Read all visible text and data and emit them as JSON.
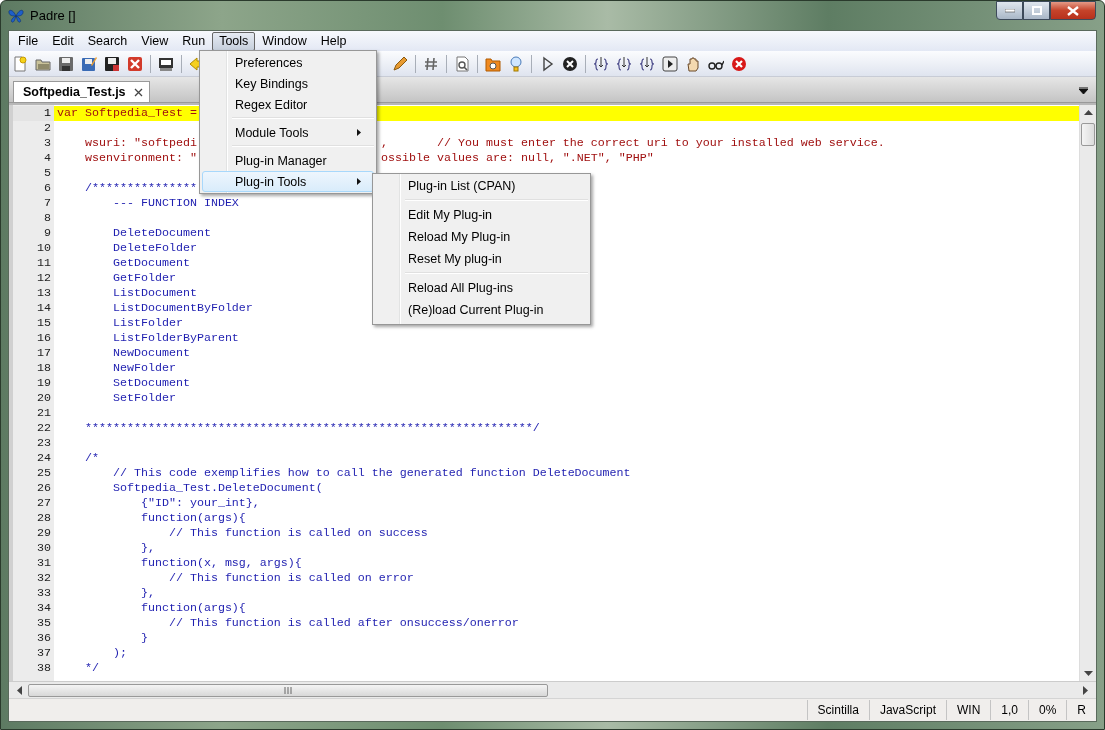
{
  "window": {
    "title": "Padre []"
  },
  "menu_bar": [
    {
      "label": "File",
      "selected": false
    },
    {
      "label": "Edit",
      "selected": false
    },
    {
      "label": "Search",
      "selected": false
    },
    {
      "label": "View",
      "selected": false
    },
    {
      "label": "Run",
      "selected": false
    },
    {
      "label": "Tools",
      "selected": true
    },
    {
      "label": "Window",
      "selected": false
    },
    {
      "label": "Help",
      "selected": false
    }
  ],
  "open_menu": {
    "items": [
      {
        "kind": "item",
        "label": "Preferences",
        "selected": false
      },
      {
        "kind": "item",
        "label": "Key Bindings",
        "selected": false
      },
      {
        "kind": "item",
        "label": "Regex Editor",
        "selected": false
      },
      {
        "kind": "separator"
      },
      {
        "kind": "submenu",
        "label": "Module Tools",
        "selected": false
      },
      {
        "kind": "separator"
      },
      {
        "kind": "item",
        "label": "Plug-in Manager",
        "selected": false
      },
      {
        "kind": "submenu",
        "label": "Plug-in Tools",
        "selected": true
      }
    ],
    "submenu": {
      "items": [
        {
          "kind": "item",
          "label": "Plug-in List (CPAN)",
          "selected": false
        },
        {
          "kind": "separator"
        },
        {
          "kind": "item",
          "label": "Edit My Plug-in",
          "selected": false
        },
        {
          "kind": "item",
          "label": "Reload My Plug-in",
          "selected": false
        },
        {
          "kind": "item",
          "label": "Reset My plug-in",
          "selected": false
        },
        {
          "kind": "separator"
        },
        {
          "kind": "item",
          "label": "Reload All Plug-ins",
          "selected": false
        },
        {
          "kind": "item",
          "label": "(Re)load Current Plug-in",
          "selected": false
        }
      ]
    }
  },
  "tabs": [
    {
      "label": "Softpedia_Test.js",
      "selected": true
    }
  ],
  "editor": {
    "lines": [
      {
        "number": "1",
        "current": true,
        "kind": "code",
        "text": "var Softpedia_Test ="
      },
      {
        "number": "2",
        "current": false,
        "kind": "code"
      },
      {
        "number": "3",
        "current": false,
        "kind": "code",
        "text": "    wsuri: \"softpedi",
        "past_menu": ",       // You must enter the correct uri to your installed web service."
      },
      {
        "number": "4",
        "current": false,
        "kind": "code",
        "text": "    wsenvironment: \"",
        "past_menu": "ossible values are: null, \".NET\", \"PHP\""
      },
      {
        "number": "5",
        "current": false,
        "kind": "code"
      },
      {
        "number": "6",
        "current": false,
        "kind": "comment",
        "text": "    /***************"
      },
      {
        "number": "7",
        "current": false,
        "kind": "comment",
        "text": "        --- FUNCTION INDEX"
      },
      {
        "number": "8",
        "current": false,
        "kind": "comment"
      },
      {
        "number": "9",
        "current": false,
        "kind": "comment",
        "text": "        DeleteDocument"
      },
      {
        "number": "10",
        "current": false,
        "kind": "comment",
        "text": "        DeleteFolder"
      },
      {
        "number": "11",
        "current": false,
        "kind": "comment",
        "text": "        GetDocument"
      },
      {
        "number": "12",
        "current": false,
        "kind": "comment",
        "text": "        GetFolder"
      },
      {
        "number": "13",
        "current": false,
        "kind": "comment",
        "text": "        ListDocument"
      },
      {
        "number": "14",
        "current": false,
        "kind": "comment",
        "text": "        ListDocumentByFolder"
      },
      {
        "number": "15",
        "current": false,
        "kind": "comment",
        "text": "        ListFolder"
      },
      {
        "number": "16",
        "current": false,
        "kind": "comment",
        "text": "        ListFolderByParent"
      },
      {
        "number": "17",
        "current": false,
        "kind": "comment",
        "text": "        NewDocument"
      },
      {
        "number": "18",
        "current": false,
        "kind": "comment",
        "text": "        NewFolder"
      },
      {
        "number": "19",
        "current": false,
        "kind": "comment",
        "text": "        SetDocument"
      },
      {
        "number": "20",
        "current": false,
        "kind": "comment",
        "text": "        SetFolder"
      },
      {
        "number": "21",
        "current": false,
        "kind": "comment"
      },
      {
        "number": "22",
        "current": false,
        "kind": "comment",
        "text": "    ****************************************************************/"
      },
      {
        "number": "23",
        "current": false,
        "kind": "code"
      },
      {
        "number": "24",
        "current": false,
        "kind": "comment",
        "text": "    /*"
      },
      {
        "number": "25",
        "current": false,
        "kind": "comment",
        "text": "        // This code exemplifies how to call the generated function DeleteDocument"
      },
      {
        "number": "26",
        "current": false,
        "kind": "comment",
        "text": "        Softpedia_Test.DeleteDocument("
      },
      {
        "number": "27",
        "current": false,
        "kind": "comment",
        "text": "            {\"ID\": your_int},"
      },
      {
        "number": "28",
        "current": false,
        "kind": "comment",
        "text": "            function(args){"
      },
      {
        "number": "29",
        "current": false,
        "kind": "comment",
        "text": "                // This function is called on success"
      },
      {
        "number": "30",
        "current": false,
        "kind": "comment",
        "text": "            },"
      },
      {
        "number": "31",
        "current": false,
        "kind": "comment",
        "text": "            function(x, msg, args){"
      },
      {
        "number": "32",
        "current": false,
        "kind": "comment",
        "text": "                // This function is called on error"
      },
      {
        "number": "33",
        "current": false,
        "kind": "comment",
        "text": "            },"
      },
      {
        "number": "34",
        "current": false,
        "kind": "comment",
        "text": "            function(args){"
      },
      {
        "number": "35",
        "current": false,
        "kind": "comment",
        "text": "                // This function is called after onsuccess/onerror"
      },
      {
        "number": "36",
        "current": false,
        "kind": "comment",
        "text": "            }"
      },
      {
        "number": "37",
        "current": false,
        "kind": "comment",
        "text": "        );"
      },
      {
        "number": "38",
        "current": false,
        "kind": "comment",
        "text": "    */"
      }
    ]
  },
  "status_bar": [
    "Scintilla",
    "JavaScript",
    "WIN",
    "1,0",
    "0%",
    "R"
  ]
}
